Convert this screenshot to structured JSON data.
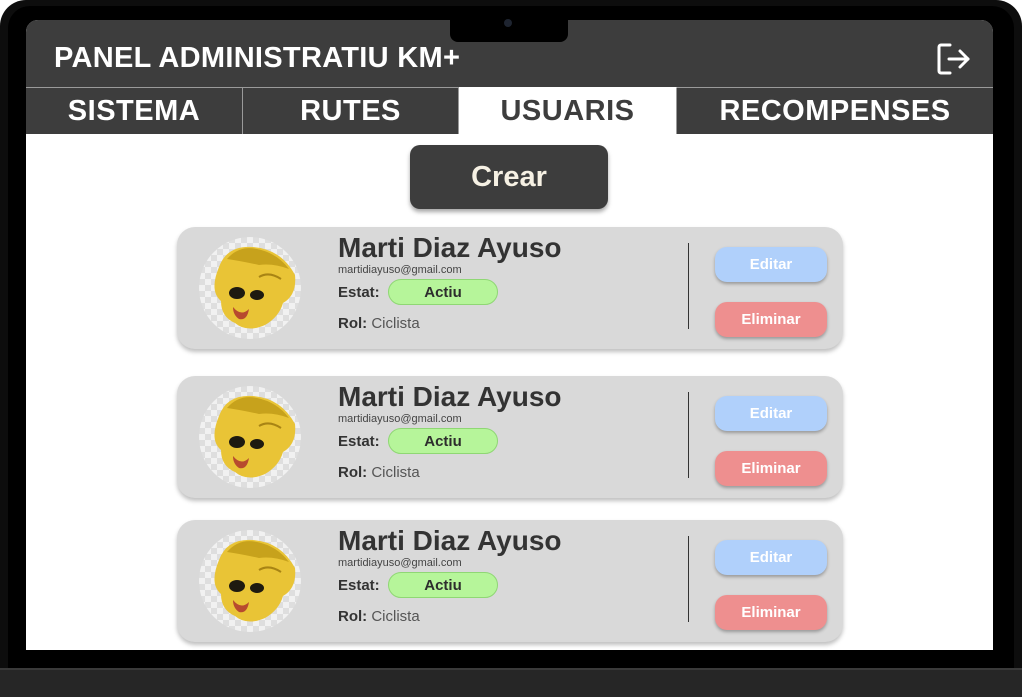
{
  "header": {
    "title": "PANEL ADMINISTRATIU KM+",
    "logout_icon": "logout-icon"
  },
  "tabs": [
    {
      "label": "SISTEMA",
      "active": false
    },
    {
      "label": "RUTES",
      "active": false
    },
    {
      "label": "USUARIS",
      "active": true
    },
    {
      "label": "RECOMPENSES",
      "active": false
    }
  ],
  "main": {
    "create_label": "Crear"
  },
  "users": [
    {
      "name": "Marti Diaz Ayuso",
      "email": "martidiayuso@gmail.com",
      "status_label": "Estat:",
      "status": "Actiu",
      "role_label": "Rol:",
      "role": "Ciclista",
      "edit_label": "Editar",
      "delete_label": "Eliminar"
    },
    {
      "name": "Marti Diaz Ayuso",
      "email": "martidiayuso@gmail.com",
      "status_label": "Estat:",
      "status": "Actiu",
      "role_label": "Rol:",
      "role": "Ciclista",
      "edit_label": "Editar",
      "delete_label": "Eliminar"
    },
    {
      "name": "Marti Diaz Ayuso",
      "email": "martidiayuso@gmail.com",
      "status_label": "Estat:",
      "status": "Actiu",
      "role_label": "Rol:",
      "role": "Ciclista",
      "edit_label": "Editar",
      "delete_label": "Eliminar"
    }
  ],
  "colors": {
    "header_bg": "#3d3d3d",
    "card_bg": "#d9d9d9",
    "status_active": "#b6f59a",
    "edit": "#b0d0fb",
    "delete": "#ee8f8f"
  }
}
